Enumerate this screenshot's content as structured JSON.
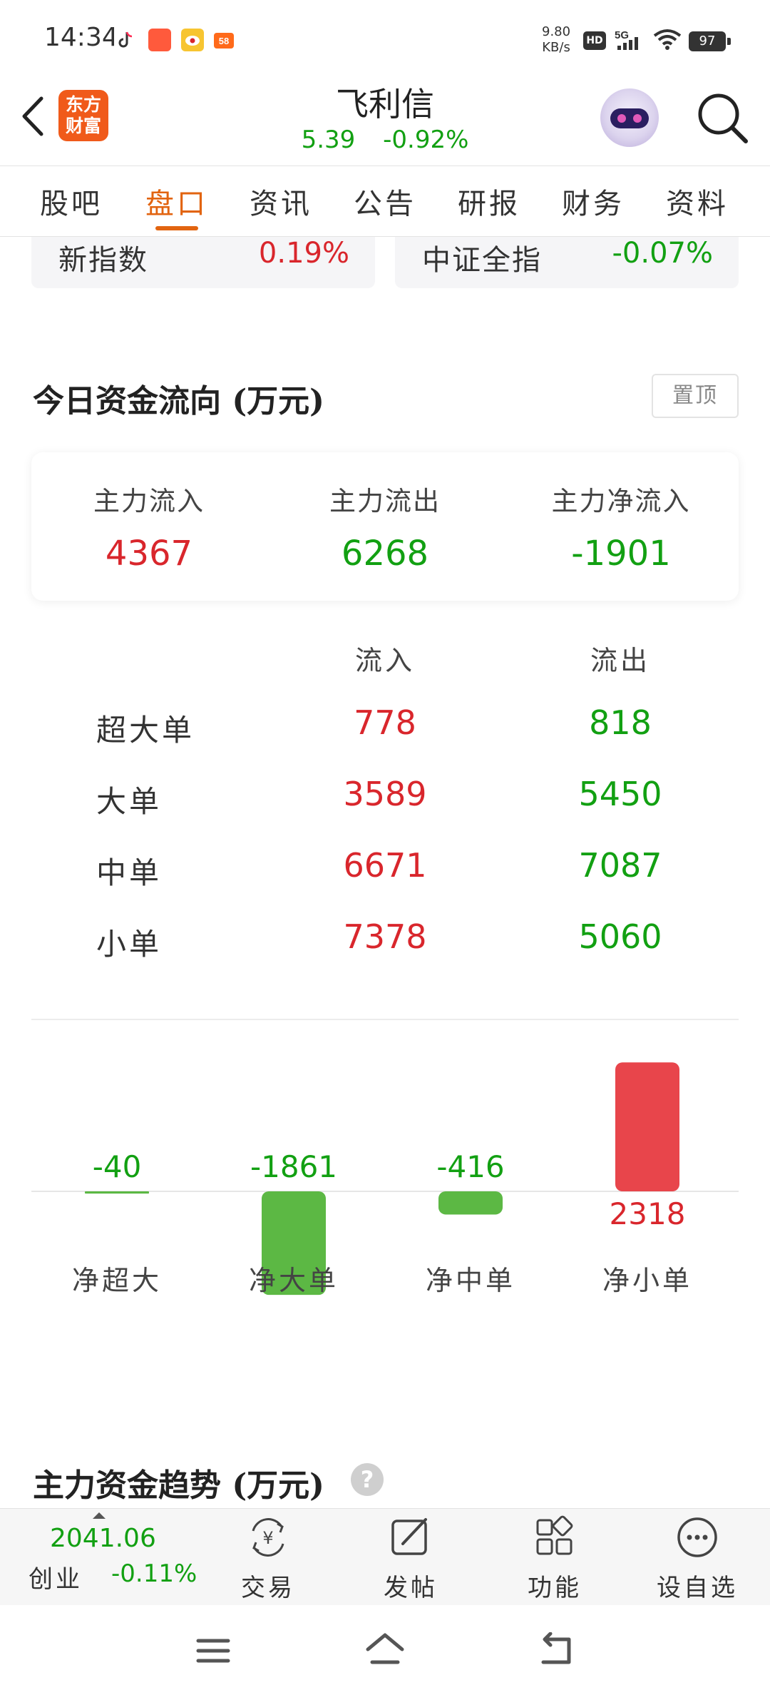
{
  "status_bar": {
    "time": "14:34",
    "speed_value": "9.80",
    "speed_unit": "KB/s",
    "hd": "HD",
    "network": "5G",
    "battery": "97"
  },
  "header": {
    "logo_line1": "东方",
    "logo_line2": "财富",
    "stock_name": "飞利信",
    "price": "5.39",
    "change_pct": "-0.92%"
  },
  "tabs": [
    {
      "label": "股吧",
      "active": false
    },
    {
      "label": "盘口",
      "active": true
    },
    {
      "label": "资讯",
      "active": false
    },
    {
      "label": "公告",
      "active": false
    },
    {
      "label": "研报",
      "active": false
    },
    {
      "label": "财务",
      "active": false
    },
    {
      "label": "资料",
      "active": false
    }
  ],
  "index_cards": [
    {
      "name": "新指数",
      "value": "0.19%"
    },
    {
      "name": "中证全指",
      "value": "-0.07%"
    }
  ],
  "fund_flow": {
    "title": "今日资金流向 (万元)",
    "pin_label": "置顶",
    "summary": [
      {
        "label": "主力流入",
        "value": "4367"
      },
      {
        "label": "主力流出",
        "value": "6268"
      },
      {
        "label": "主力净流入",
        "value": "-1901"
      }
    ],
    "table_headers": {
      "in": "流入",
      "out": "流出"
    },
    "rows": [
      {
        "label": "超大单",
        "in": "778",
        "out": "818"
      },
      {
        "label": "大单",
        "in": "3589",
        "out": "5450"
      },
      {
        "label": "中单",
        "in": "6671",
        "out": "7087"
      },
      {
        "label": "小单",
        "in": "7378",
        "out": "5060"
      }
    ]
  },
  "chart_data": {
    "type": "bar",
    "categories": [
      "净超大",
      "净大单",
      "净中单",
      "净小单"
    ],
    "values": [
      -40,
      -1861,
      -416,
      2318
    ],
    "value_labels": [
      "-40",
      "-1861",
      "-416",
      "2318"
    ],
    "colors": {
      "positive": "#e8454b",
      "negative": "#5cb844"
    },
    "title": "",
    "xlabel": "",
    "ylabel": "",
    "grid": false
  },
  "trend_section": {
    "title": "主力资金趋势 (万元)",
    "help_icon": "?"
  },
  "bottom_bar": {
    "index_value": "2041.06",
    "index_name": "创业",
    "index_pct": "-0.11%",
    "tools": [
      {
        "label": "交易",
        "icon": "trade-icon"
      },
      {
        "label": "发帖",
        "icon": "post-icon"
      },
      {
        "label": "功能",
        "icon": "functions-icon"
      },
      {
        "label": "设自选",
        "icon": "more-icon"
      }
    ]
  },
  "colors": {
    "up": "#d9262c",
    "down": "#12a012",
    "accent": "#e26410",
    "brand": "#f05a1a"
  }
}
